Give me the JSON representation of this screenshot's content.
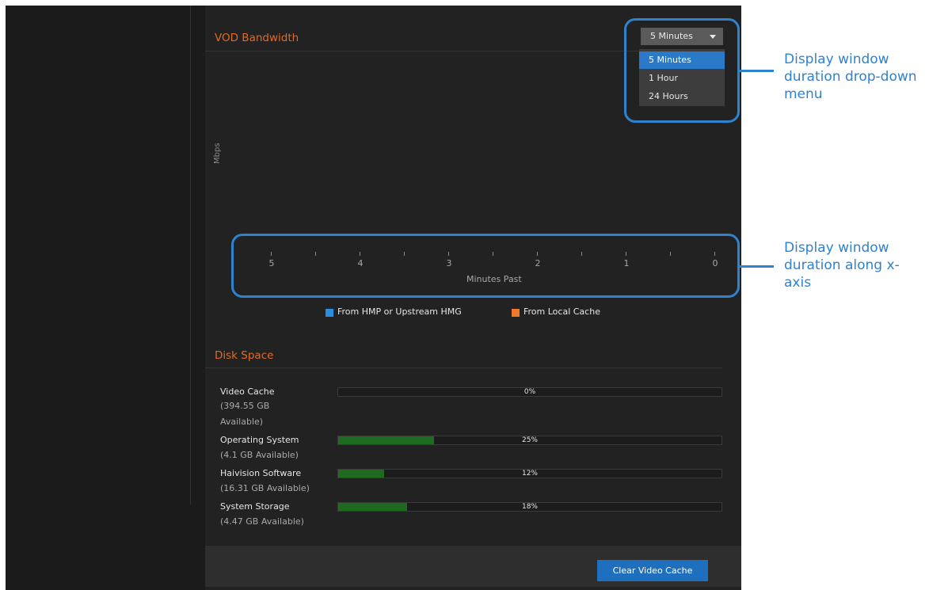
{
  "vod": {
    "title": "VOD Bandwidth",
    "dropdown_value": "5 Minutes",
    "dropdown_options": [
      "5 Minutes",
      "1 Hour",
      "24 Hours"
    ],
    "selected_index": 0,
    "y_axis_label": "Mbps",
    "x_axis_label": "Minutes Past",
    "x_ticks": [
      "5",
      "4",
      "3",
      "2",
      "1",
      "0"
    ],
    "legend": [
      {
        "label": "From HMP or Upstream HMG",
        "color": "#2a8fe0"
      },
      {
        "label": "From Local Cache",
        "color": "#f07a2a"
      }
    ]
  },
  "disk": {
    "title": "Disk Space",
    "items": [
      {
        "name": "Video Cache",
        "avail": "(394.55 GB Available)",
        "percent_label": "0%",
        "fraction": 0.0
      },
      {
        "name": "Operating System",
        "avail": "(4.1 GB Available)",
        "percent_label": "25%",
        "fraction": 0.25
      },
      {
        "name": "Haivision Software",
        "avail": "(16.31 GB Available)",
        "percent_label": "12%",
        "fraction": 0.12
      },
      {
        "name": "System Storage",
        "avail": "(4.47 GB Available)",
        "percent_label": "18%",
        "fraction": 0.18
      }
    ]
  },
  "footer": {
    "clear_cache_label": "Clear Video Cache"
  },
  "annotations": {
    "dropdown_note": "Display window duration drop-down menu",
    "axis_note": "Display window duration along x-axis",
    "color": "#2f82cf"
  }
}
